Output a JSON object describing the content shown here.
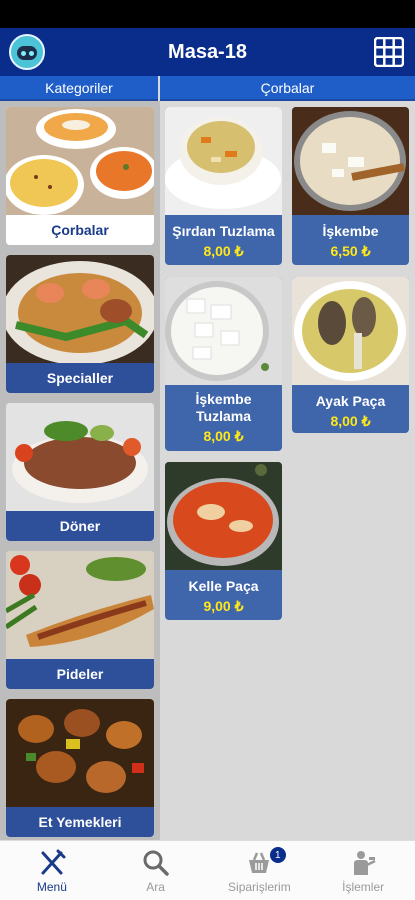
{
  "header": {
    "title": "Masa-18"
  },
  "subheads": {
    "left": "Kategoriler",
    "right": "Çorbalar"
  },
  "categories": [
    {
      "label": "Çorbalar",
      "active": true
    },
    {
      "label": "Specialler"
    },
    {
      "label": "Döner"
    },
    {
      "label": "Pideler"
    },
    {
      "label": "Et Yemekleri"
    }
  ],
  "items": [
    {
      "name": "Şırdan Tuzlama",
      "price": "8,00 ₺"
    },
    {
      "name": "İşkembe",
      "price": "6,50 ₺"
    },
    {
      "name": "İşkembe Tuzlama",
      "price": "8,00 ₺"
    },
    {
      "name": "Ayak Paça",
      "price": "8,00 ₺"
    },
    {
      "name": "Kelle Paça",
      "price": "9,00 ₺"
    }
  ],
  "nav": [
    {
      "label": "Menü",
      "icon": "fork-knife-icon",
      "active": true
    },
    {
      "label": "Ara",
      "icon": "search-icon"
    },
    {
      "label": "Siparişlerim",
      "icon": "basket-icon",
      "badge": "1"
    },
    {
      "label": "İşlemler",
      "icon": "waiter-icon"
    }
  ],
  "colors": {
    "appbar": "#0a2d8c",
    "subhead": "#1f5ec8",
    "card": "#3f65ab",
    "price": "#ffe81a"
  }
}
